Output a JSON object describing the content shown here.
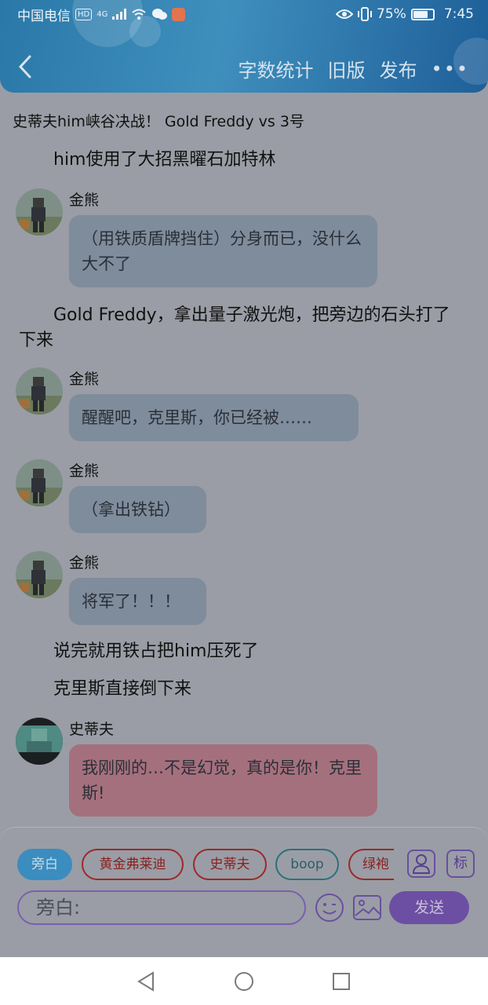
{
  "status": {
    "carrier": "中国电信",
    "hd": "HD",
    "net": "4G",
    "battery": "75%",
    "battery_level": 0.75,
    "time": "7:45"
  },
  "nav": {
    "word_count": "字数统计",
    "old_version": "旧版",
    "publish": "发布",
    "more": "•••"
  },
  "story": {
    "title": "史蒂夫him峡谷决战！ Gold Freddy vs 3号",
    "narration_1": "him使用了大招黑曜石加特林",
    "msg_1": {
      "speaker": "金熊",
      "text": "（用铁质盾牌挡住）分身而已，没什么大不了"
    },
    "narration_2": "Gold Freddy，拿出量子激光炮，把旁边的石头打了下来",
    "msg_2": {
      "speaker": "金熊",
      "text": "醒醒吧，克里斯，你已经被……"
    },
    "msg_3": {
      "speaker": "金熊",
      "text": "（拿出铁钻）"
    },
    "msg_4": {
      "speaker": "金熊",
      "text": "将军了！！！"
    },
    "narration_3": "说完就用铁占把him压死了",
    "narration_4": "克里斯直接倒下来",
    "msg_5": {
      "speaker": "史蒂夫",
      "text": "我刚刚的…不是幻觉，真的是你！克里斯!"
    }
  },
  "composer": {
    "chips": [
      "旁白",
      "黄金弗莱迪",
      "史蒂夫",
      "boop",
      "绿袍"
    ],
    "tag_label": "标",
    "input_placeholder": "旁白:",
    "send_label": "发送"
  }
}
